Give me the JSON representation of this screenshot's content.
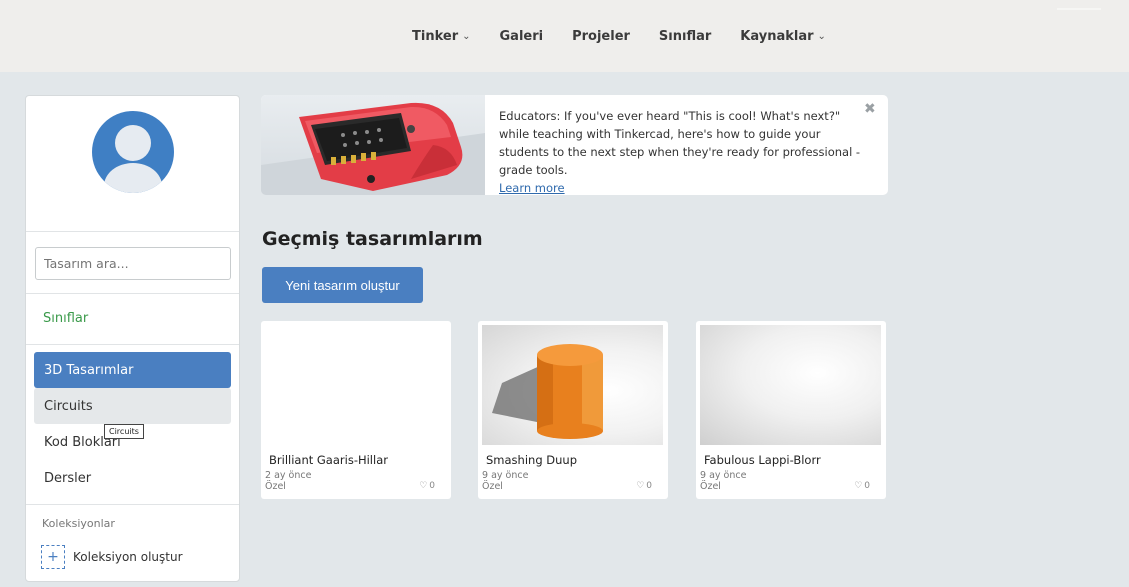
{
  "nav": {
    "items": [
      {
        "label": "Tinker",
        "has_dropdown": true
      },
      {
        "label": "Galeri",
        "has_dropdown": false
      },
      {
        "label": "Projeler",
        "has_dropdown": false
      },
      {
        "label": "Sınıflar",
        "has_dropdown": false
      },
      {
        "label": "Kaynaklar",
        "has_dropdown": true
      }
    ],
    "chevron_icon": "chevron-down-icon"
  },
  "sidebar": {
    "avatar_icon": "user-avatar-icon",
    "search_placeholder": "Tasarım ara...",
    "classes_link": "Sınıflar",
    "menu": [
      {
        "label": "3D Tasarımlar",
        "state": "active"
      },
      {
        "label": "Circuits",
        "state": "hover"
      },
      {
        "label": "Kod Blokları",
        "state": "normal"
      },
      {
        "label": "Dersler",
        "state": "normal"
      }
    ],
    "tooltip": "Circuits",
    "collections_label": "Koleksiyonlar",
    "create_collection": "Koleksiyon oluştur",
    "create_collection_icon": "plus-icon"
  },
  "banner": {
    "text": "Educators: If you've ever heard \"This is cool! What's next?\" while teaching with Tinkercad, here's how to guide your students to the next step when they're ready for professional - grade tools.",
    "link": "Learn more",
    "close_icon": "close-icon"
  },
  "main": {
    "title": "Geçmiş tasarımlarım",
    "new_button": "Yeni tasarım oluştur",
    "cards": [
      {
        "name": "Brilliant Gaaris-Hillar",
        "time": "2 ay önce",
        "visibility": "Özel",
        "likes": "0"
      },
      {
        "name": "Smashing Duup",
        "time": "9 ay önce",
        "visibility": "Özel",
        "likes": "0"
      },
      {
        "name": "Fabulous Lappi-Blorr",
        "time": "9 ay önce",
        "visibility": "Özel",
        "likes": "0"
      }
    ],
    "like_icon": "heart-icon"
  },
  "colors": {
    "accent": "#4a7fc1",
    "classes_green": "#3a9a4a",
    "nav_bg": "#efeeec",
    "page_bg": "#e2e7ea",
    "cylinder_orange": "#f08a24"
  }
}
